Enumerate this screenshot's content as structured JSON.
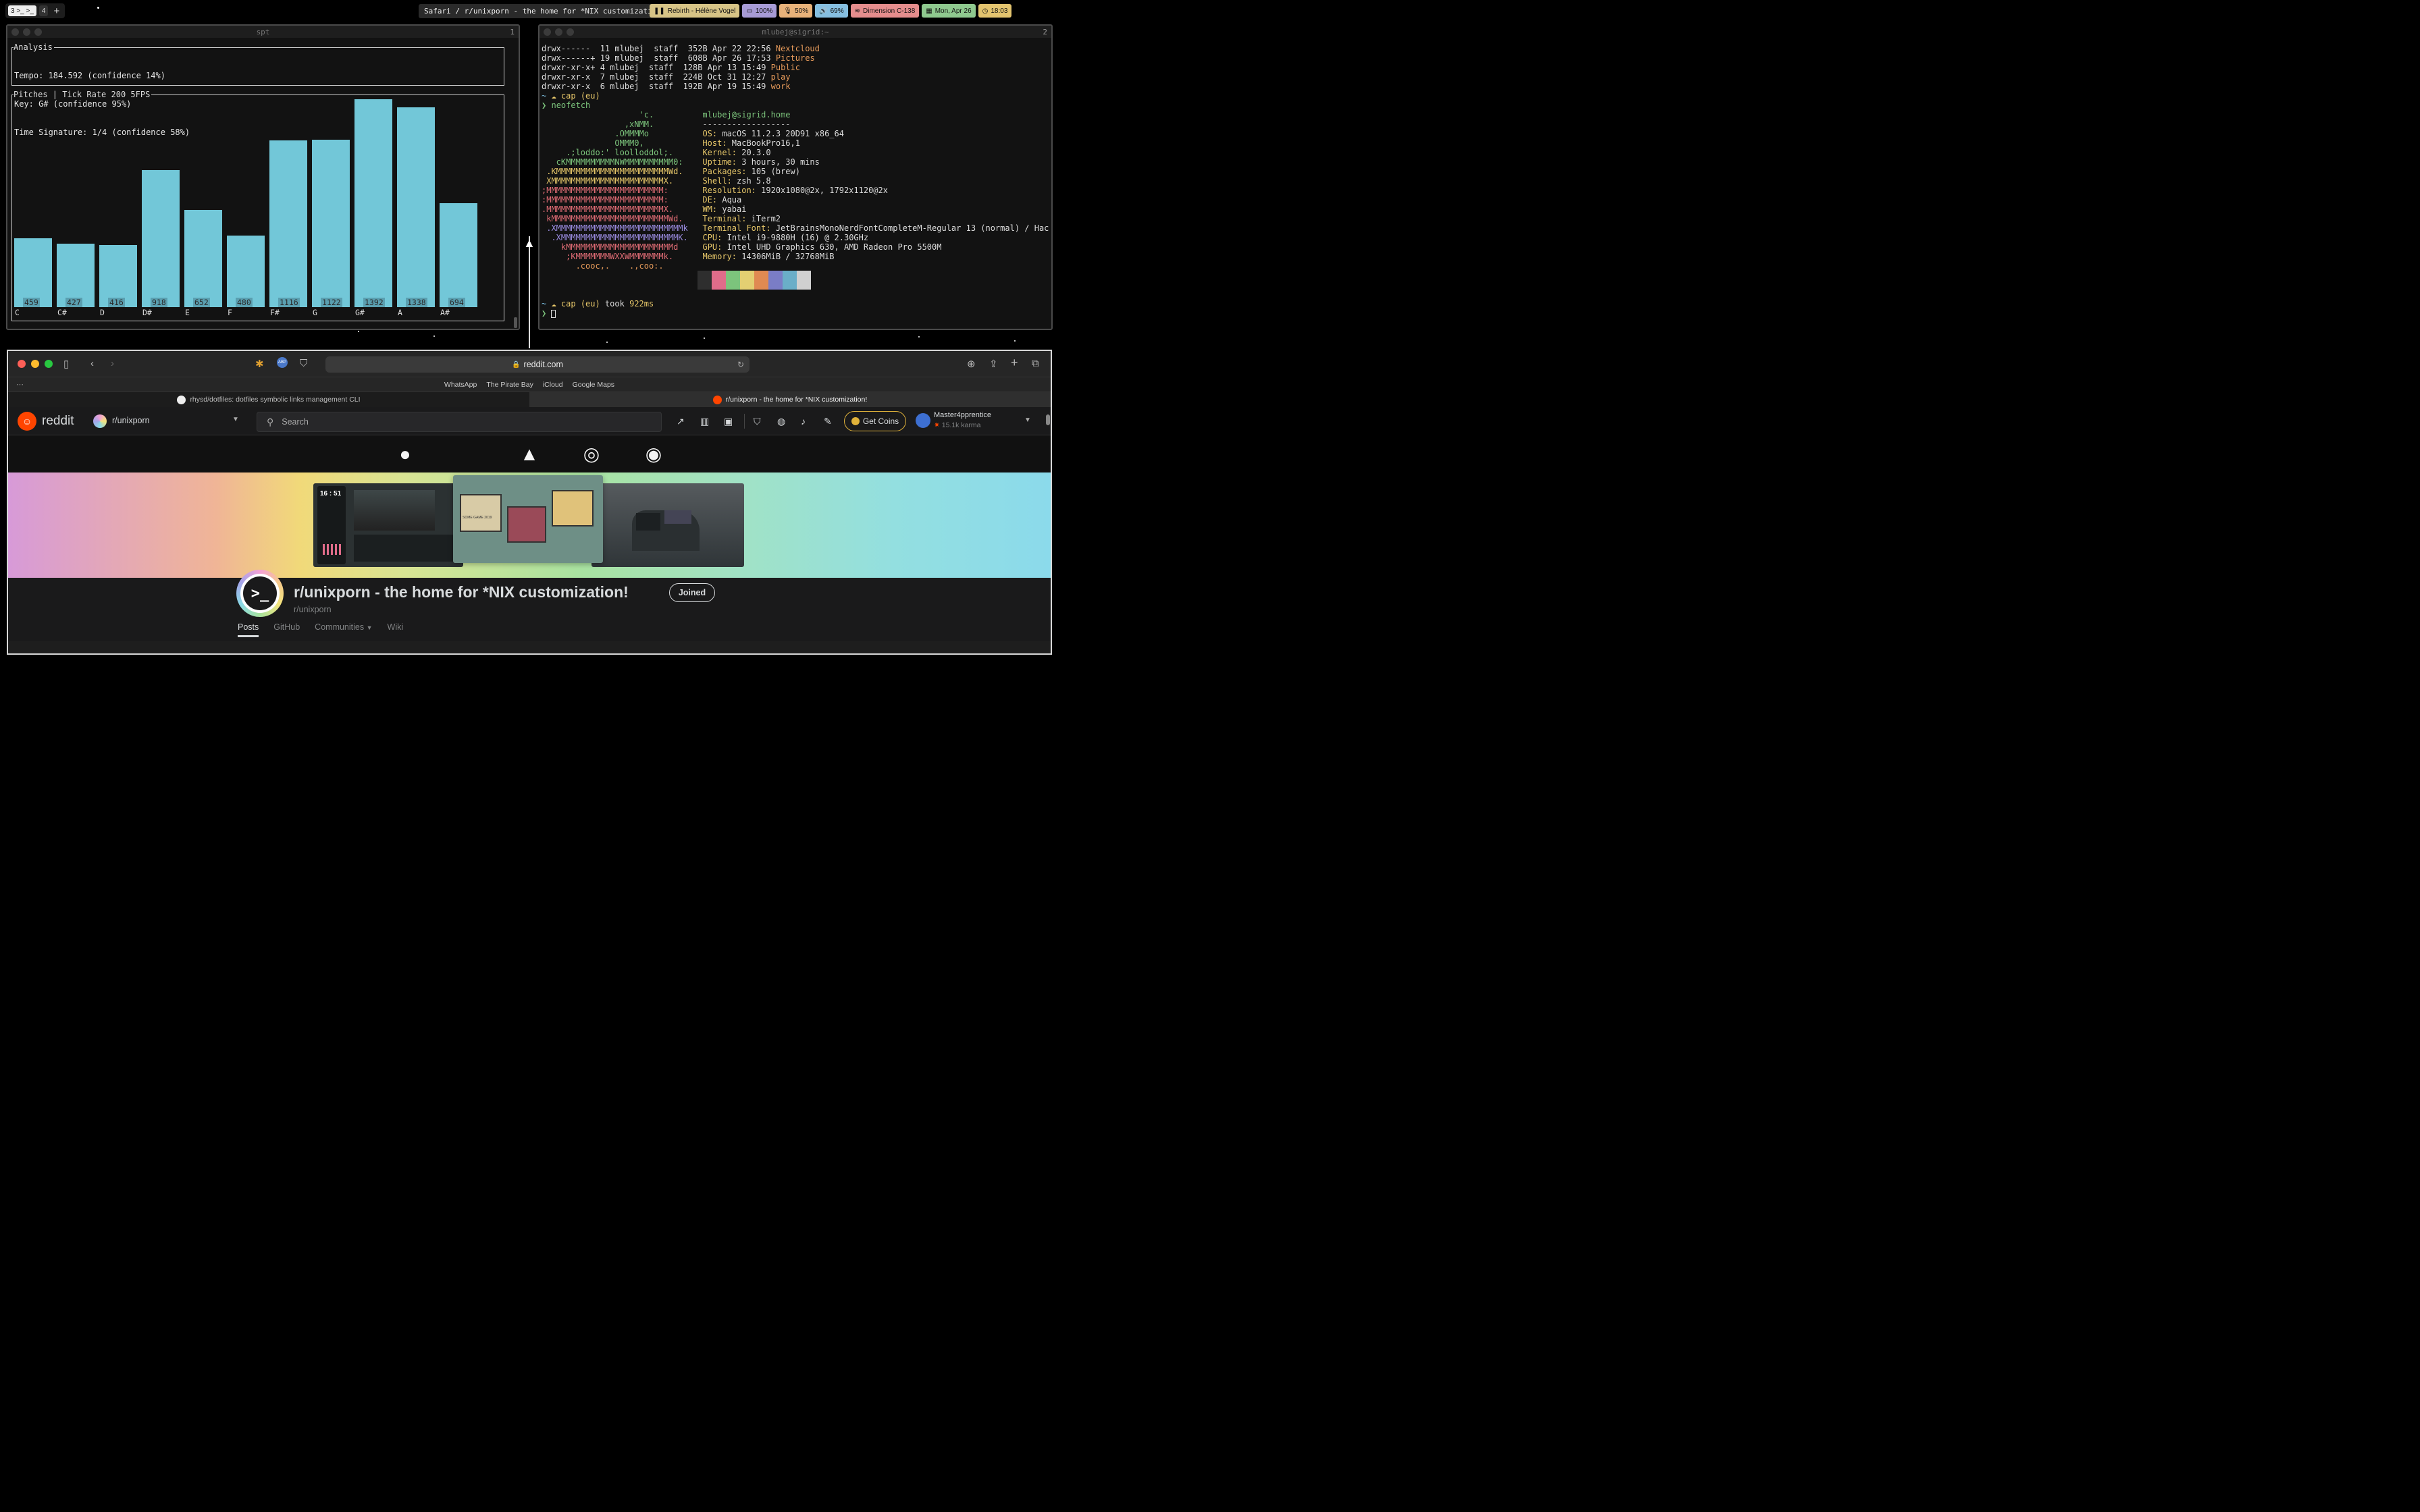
{
  "menubar": {
    "spaces": [
      {
        "label": "3 >_ >_",
        "active": true
      },
      {
        "label": "4",
        "active": false
      }
    ],
    "add_label": "+",
    "focused_title": "Safari / r/unixporn - the home for *NIX customization!",
    "status": [
      {
        "icon": "pause-icon",
        "glyph": "❚❚",
        "label": "Rebirth - Hélène Vogel",
        "color": "#d7c486"
      },
      {
        "icon": "battery-icon",
        "glyph": "▭",
        "label": "100%",
        "color": "#a79bd6"
      },
      {
        "icon": "microphone-icon",
        "glyph": "🎙",
        "label": "50%",
        "color": "#e8b27a"
      },
      {
        "icon": "volume-icon",
        "glyph": "🔊",
        "label": "69%",
        "color": "#86bfe0"
      },
      {
        "icon": "wifi-icon",
        "glyph": "≋",
        "label": "Dimension C-138",
        "color": "#e58d8d"
      },
      {
        "icon": "calendar-icon",
        "glyph": "▦",
        "label": "Mon, Apr 26",
        "color": "#8fc98f"
      },
      {
        "icon": "clock-icon",
        "glyph": "◷",
        "label": "18:03",
        "color": "#e3c46f"
      }
    ]
  },
  "spt": {
    "title": "spt",
    "window_number": "1",
    "analysis_label": "Analysis",
    "analysis_lines": [
      "Tempo: 184.592 (confidence 14%)",
      "Key: G# (confidence 95%)",
      "Time Signature: 1/4 (confidence 58%)"
    ],
    "pitches_label": "Pitches | Tick Rate 200 5FPS",
    "chart_data": {
      "type": "bar",
      "categories": [
        "C",
        "C#",
        "D",
        "D#",
        "E",
        "F",
        "F#",
        "G",
        "G#",
        "A",
        "A#"
      ],
      "values": [
        459,
        427,
        416,
        918,
        652,
        480,
        1116,
        1122,
        1392,
        1338,
        694
      ],
      "ylim": [
        0,
        1392
      ],
      "color": "#72c7d8"
    }
  },
  "terminal": {
    "title": "mlubej@sigrid:~",
    "window_number": "2",
    "ls_rows": [
      {
        "perm": "drwx------",
        "n": "11",
        "user": "mlubej",
        "group": "staff",
        "size": "352B",
        "date": "Apr 22 22:56",
        "name": "Nextcloud"
      },
      {
        "perm": "drwx------+",
        "n": "19",
        "user": "mlubej",
        "group": "staff",
        "size": "608B",
        "date": "Apr 26 17:53",
        "name": "Pictures"
      },
      {
        "perm": "drwxr-xr-x+",
        "n": "4",
        "user": "mlubej",
        "group": "staff",
        "size": "128B",
        "date": "Apr 13 15:49",
        "name": "Public"
      },
      {
        "perm": "drwxr-xr-x",
        "n": "7",
        "user": "mlubej",
        "group": "staff",
        "size": "224B",
        "date": "Oct 31 12:27",
        "name": "play"
      },
      {
        "perm": "drwxr-xr-x",
        "n": "6",
        "user": "mlubej",
        "group": "staff",
        "size": "192B",
        "date": "Apr 19 15:49",
        "name": "work"
      }
    ],
    "prompt_path": "~",
    "prompt_cloud": "cap (eu)",
    "command": "neofetch",
    "ascii_art": [
      "                    'c.",
      "                 ,xNMM.",
      "               .OMMMMo",
      "               OMMM0,",
      "     .;loddo:' loolloddol;.",
      "   cKMMMMMMMMMMNWMMMMMMMMMM0:",
      " .KMMMMMMMMMMMMMMMMMMMMMMMWd.",
      " XMMMMMMMMMMMMMMMMMMMMMMMX.",
      ";MMMMMMMMMMMMMMMMMMMMMMMM:",
      ":MMMMMMMMMMMMMMMMMMMMMMMM:",
      ".MMMMMMMMMMMMMMMMMMMMMMMMX.",
      " kMMMMMMMMMMMMMMMMMMMMMMMMWd.",
      " .XMMMMMMMMMMMMMMMMMMMMMMMMMMk",
      "  .XMMMMMMMMMMMMMMMMMMMMMMMMK.",
      "    kMMMMMMMMMMMMMMMMMMMMMMd",
      "     ;KMMMMMMMWXXWMMMMMMMk.",
      "       .cooc,.    .,coo:."
    ],
    "user_host": "mlubej@sigrid.home",
    "separator": "------------------",
    "info": [
      {
        "k": "OS",
        "v": "macOS 11.2.3 20D91 x86_64"
      },
      {
        "k": "Host",
        "v": "MacBookPro16,1"
      },
      {
        "k": "Kernel",
        "v": "20.3.0"
      },
      {
        "k": "Uptime",
        "v": "3 hours, 30 mins"
      },
      {
        "k": "Packages",
        "v": "105 (brew)"
      },
      {
        "k": "Shell",
        "v": "zsh 5.8"
      },
      {
        "k": "Resolution",
        "v": "1920x1080@2x, 1792x1120@2x"
      },
      {
        "k": "DE",
        "v": "Aqua"
      },
      {
        "k": "WM",
        "v": "yabai"
      },
      {
        "k": "Terminal",
        "v": "iTerm2"
      },
      {
        "k": "Terminal Font",
        "v": "JetBrainsMonoNerdFontCompleteM-Regular 13 (normal) / Hac"
      },
      {
        "k": "CPU",
        "v": "Intel i9-9880H (16) @ 2.30GHz"
      },
      {
        "k": "GPU",
        "v": "Intel UHD Graphics 630, AMD Radeon Pro 5500M"
      },
      {
        "k": "Memory",
        "v": "14306MiB / 32768MiB"
      }
    ],
    "palette": [
      "#2e2e2e",
      "#e06c8a",
      "#7cc47c",
      "#e3cf72",
      "#e08a52",
      "#7a7dc6",
      "#6aaec8",
      "#d0d0d0"
    ],
    "took_label": "took",
    "took_value": "922ms"
  },
  "safari": {
    "url": "reddit.com",
    "favorites": [
      "WhatsApp",
      "The Pirate Bay",
      "iCloud",
      "Google Maps"
    ],
    "tabs": [
      {
        "label": "rhysd/dotfiles: dotfiles symbolic links management CLI",
        "active": false
      },
      {
        "label": "r/unixporn - the home for *NIX customization!",
        "active": true
      }
    ]
  },
  "reddit": {
    "brand": "reddit",
    "community": "r/unixporn",
    "search_placeholder": "Search",
    "get_coins": "Get Coins",
    "username": "Master4pprentice",
    "karma": "15.1k karma",
    "sub_title": "r/unixporn - the home for *NIX customization!",
    "sub_name": "r/unixporn",
    "joined": "Joined",
    "nav": [
      "Posts",
      "GitHub",
      "Communities",
      "Wiki"
    ],
    "banner_clock": "16 : 51",
    "banner_tag": "SOME GAME 2019"
  }
}
